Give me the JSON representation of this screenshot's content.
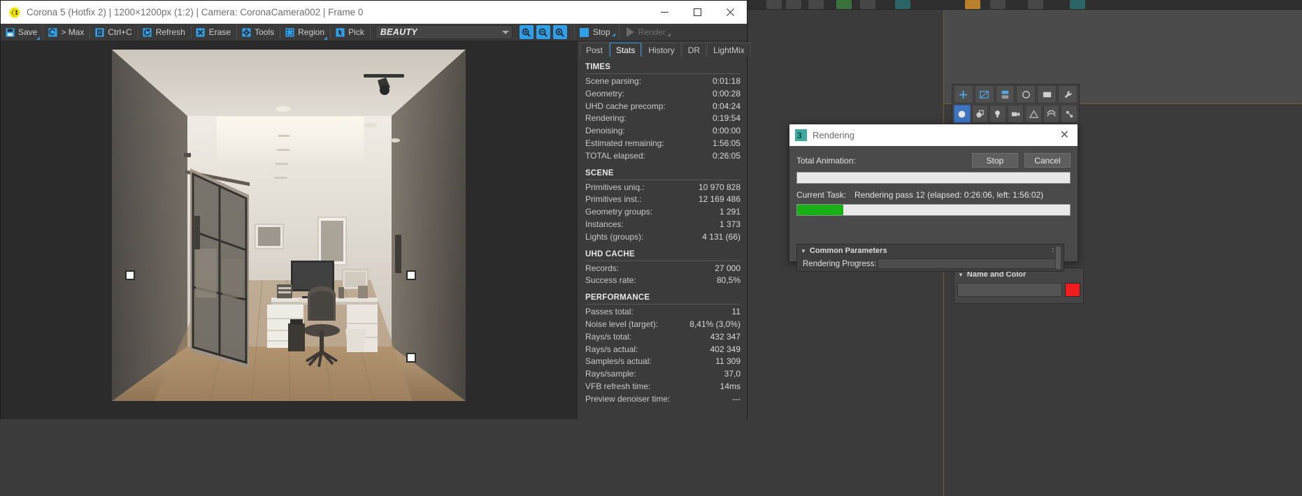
{
  "vfb": {
    "title": "Corona 5 (Hotfix 2) | 1200×1200px (1:2) | Camera: CoronaCamera002 | Frame 0",
    "logo_icon": "corona-logo-icon",
    "window_controls": [
      {
        "name": "minimize-button",
        "glyph": "minimize-icon"
      },
      {
        "name": "maximize-button",
        "glyph": "maximize-icon"
      },
      {
        "name": "close-button",
        "glyph": "close-icon"
      }
    ],
    "toolbar": [
      {
        "label": "Save",
        "icon": "save-icon",
        "arrow": true
      },
      {
        "label": "> Max",
        "icon": "to-max-icon",
        "arrow": false
      },
      {
        "label": "Ctrl+C",
        "icon": "copy-icon",
        "arrow": false
      },
      {
        "label": "Refresh",
        "icon": "refresh-icon",
        "arrow": false
      },
      {
        "label": "Erase",
        "icon": "erase-icon",
        "arrow": false
      },
      {
        "label": "Tools",
        "icon": "tools-gear-icon",
        "arrow": false
      },
      {
        "label": "Region",
        "icon": "region-icon",
        "arrow": true
      },
      {
        "label": "Pick",
        "icon": "pick-icon",
        "arrow": false
      }
    ],
    "render_element": "BEAUTY",
    "zoom_buttons": [
      {
        "name": "zoom-in-button",
        "icon": "magnifier-plus-icon"
      },
      {
        "name": "zoom-out-button",
        "icon": "magnifier-minus-icon"
      },
      {
        "name": "zoom-reset-button",
        "icon": "magnifier-reset-icon"
      }
    ],
    "stop_label": "Stop",
    "render_label": "Render"
  },
  "stats": {
    "tabs": [
      {
        "label": "Post",
        "active": false
      },
      {
        "label": "Stats",
        "active": true
      },
      {
        "label": "History",
        "active": false
      },
      {
        "label": "DR",
        "active": false
      },
      {
        "label": "LightMix",
        "active": false
      }
    ],
    "sections": [
      {
        "title": "TIMES",
        "rows": [
          {
            "label": "Scene parsing:",
            "value": "0:01:18"
          },
          {
            "label": "Geometry:",
            "value": "0:00:28"
          },
          {
            "label": "UHD cache precomp:",
            "value": "0:04:24"
          },
          {
            "label": "Rendering:",
            "value": "0:19:54"
          },
          {
            "label": "Denoising:",
            "value": "0:00:00"
          },
          {
            "label": "Estimated remaining:",
            "value": "1:56:05"
          },
          {
            "label": "TOTAL elapsed:",
            "value": "0:26:05"
          }
        ]
      },
      {
        "title": "SCENE",
        "rows": [
          {
            "label": "Primitives uniq.:",
            "value": "10 970 828"
          },
          {
            "label": "Primitives inst.:",
            "value": "12 169 486"
          },
          {
            "label": "Geometry groups:",
            "value": "1 291"
          },
          {
            "label": "Instances:",
            "value": "1 373"
          },
          {
            "label": "Lights (groups):",
            "value": "4 131 (66)"
          }
        ]
      },
      {
        "title": "UHD CACHE",
        "rows": [
          {
            "label": "Records:",
            "value": "27 000"
          },
          {
            "label": "Success rate:",
            "value": "80,5%"
          }
        ]
      },
      {
        "title": "PERFORMANCE",
        "rows": [
          {
            "label": "Passes total:",
            "value": "11"
          },
          {
            "label": "Noise level (target):",
            "value": "8,41% (3,0%)"
          },
          {
            "label": "Rays/s total:",
            "value": "432 347"
          },
          {
            "label": "Rays/s actual:",
            "value": "402 349"
          },
          {
            "label": "Samples/s actual:",
            "value": "11 309"
          },
          {
            "label": "Rays/sample:",
            "value": "37,0"
          },
          {
            "label": "VFB refresh time:",
            "value": "14ms"
          },
          {
            "label": "Preview denoiser time:",
            "value": "---"
          }
        ]
      }
    ]
  },
  "rendering_dialog": {
    "title": "Rendering",
    "logo_icon": "3dsmax-logo-icon",
    "close_icon": "close-icon",
    "total_animation_label": "Total Animation:",
    "total_animation_progress": 0,
    "stop_label": "Stop",
    "cancel_label": "Cancel",
    "current_task_label": "Current Task:",
    "current_task_value": "Rendering pass 12 (elapsed: 0:26:06, left: 1:56:02)",
    "current_task_progress": 17,
    "progress_color": "#17b017",
    "rollout": {
      "title": "Common Parameters",
      "collapse_icon": "triangle-down-icon",
      "field_label": "Rendering Progress:"
    }
  },
  "max_panel": {
    "command_icons": [
      {
        "name": "create-tab-icon",
        "glyph": "+"
      },
      {
        "name": "modify-tab-icon",
        "glyph": "modify-icon"
      },
      {
        "name": "hierarchy-tab-icon",
        "glyph": "hierarchy-icon"
      },
      {
        "name": "motion-tab-icon",
        "glyph": "motion-icon"
      },
      {
        "name": "display-tab-icon",
        "glyph": "display-icon"
      },
      {
        "name": "utilities-tab-icon",
        "glyph": "wrench-icon"
      }
    ],
    "create_icons": [
      {
        "name": "geometry-icon",
        "glyph": "sphere-icon",
        "selected": true
      },
      {
        "name": "shapes-icon",
        "glyph": "shapes-icon",
        "selected": false
      },
      {
        "name": "lights-icon",
        "glyph": "bulb-icon",
        "selected": false
      },
      {
        "name": "cameras-icon",
        "glyph": "camera-icon",
        "selected": false
      },
      {
        "name": "helpers-icon",
        "glyph": "helper-icon",
        "selected": false
      },
      {
        "name": "space-warps-icon",
        "glyph": "warp-icon",
        "selected": false
      },
      {
        "name": "systems-icon",
        "glyph": "systems-icon",
        "selected": false
      }
    ],
    "name_and_color": {
      "title": "Name and Color",
      "collapse_icon": "triangle-down-icon",
      "name_value": "",
      "color_swatch": "#ef1d1d"
    }
  }
}
